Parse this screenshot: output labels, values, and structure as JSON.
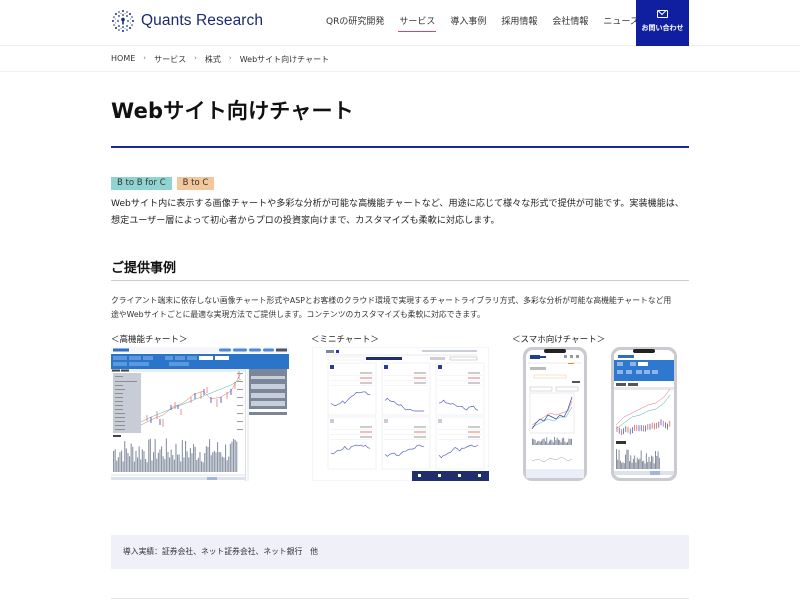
{
  "header": {
    "logo_text": "Quants Research",
    "nav": [
      {
        "label": "QRの研究開発",
        "active": false
      },
      {
        "label": "サービス",
        "active": true
      },
      {
        "label": "導入事例",
        "active": false
      },
      {
        "label": "採用情報",
        "active": false
      },
      {
        "label": "会社情報",
        "active": false
      },
      {
        "label": "ニュース",
        "active": false
      }
    ],
    "contact_label": "お問い合わせ",
    "contact_icon": "mail-icon",
    "colors": {
      "brand": "#0f1fa0",
      "nav_active_underline": "#d6417b"
    }
  },
  "breadcrumb": [
    "HOME",
    "サービス",
    "株式",
    "Webサイト向けチャート"
  ],
  "breadcrumb_separator": "›",
  "page": {
    "title": "Webサイト向けチャート",
    "tags": [
      {
        "label": "B to B for C",
        "color": "#8fd4d2"
      },
      {
        "label": "B to C",
        "color": "#f3c69c"
      }
    ],
    "intro_line1": "Webサイト内に表示する画像チャートや多彩な分析が可能な高機能チャートなど、用途に応じて様々な形式で提供が可能です。実装機能は、",
    "intro_line2": "想定ユーザー層によって初心者からプロの投資家向けまで、カスタマイズも柔軟に対応します。",
    "section_title": "ご提供事例",
    "section_desc_line1": "クライアント端末に依存しない画像チャート形式やASPとお客様のクラウド環境で実現するチャートライブラリ方式、多彩な分析が可能な高機能チャートなど用",
    "section_desc_line2": "途やWebサイトごとに最適な実現方法でご提供します。コンテンツのカスタマイズも柔軟に対応できます。",
    "samples": [
      {
        "label": "＜高機能チャート＞",
        "image": "advanced-chart-screenshot"
      },
      {
        "label": "＜ミニチャート＞",
        "image": "mini-chart-screenshot"
      },
      {
        "label": "＜スマホ向けチャート＞",
        "image": "smartphone-chart-screenshot"
      }
    ],
    "results_text": "導入実績：証券会社、ネット証券会社、ネット銀行　他"
  }
}
